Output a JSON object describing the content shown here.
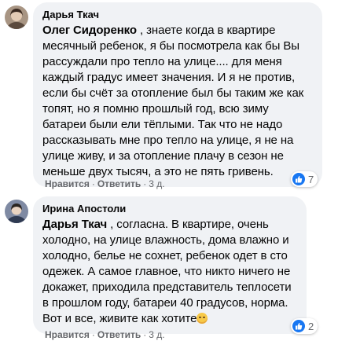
{
  "comments": [
    {
      "author": "Дарья Ткач",
      "mention": "Олег Сидоренко",
      "text": " , знаете когда в квартире месячный ребенок, я бы посмотрела как бы Вы рассуждали про тепло на улице.... для меня каждый градус имеет значения. И я не против, если бы счёт за отопление был бы таким же как топят, но я помню прошлый год, всю зиму батареи были ели тёплыми. Так что не надо рассказывать мне про тепло на улице, я не на улице живу, и за отопление плачу в сезон не меньше двух тысяч, а это не пять гривень.",
      "like_label": "Нравится",
      "reply_label": "Ответить",
      "time": "3 д.",
      "reaction_count": "7",
      "avatar_colors": [
        "#8a7a6a",
        "#c9b8a3"
      ]
    },
    {
      "author": "Ирина Апостоли",
      "mention": "Дарья Ткач",
      "text": " , согласна. В квартире, очень холодно, на улице влажность, дома влажно и холодно, белье не сохнет, ребенок одет в сто одежек. А самое главное, что никто ничего не докажет, приходила представитель теплосети в прошлом году, батареи 40 градусов, норма. Вот и все, живите как хотите",
      "like_label": "Нравится",
      "reply_label": "Ответить",
      "time": "3 д.",
      "reaction_count": "2",
      "avatar_colors": [
        "#5a6a88",
        "#d8c6b6"
      ]
    }
  ],
  "colors": {
    "bubble": "#f0f2f5",
    "secondary_text": "#65676b",
    "like_blue": "#1877f2"
  },
  "icons": {
    "reaction": "like-icon",
    "emoji": "smiling-face-icon"
  }
}
